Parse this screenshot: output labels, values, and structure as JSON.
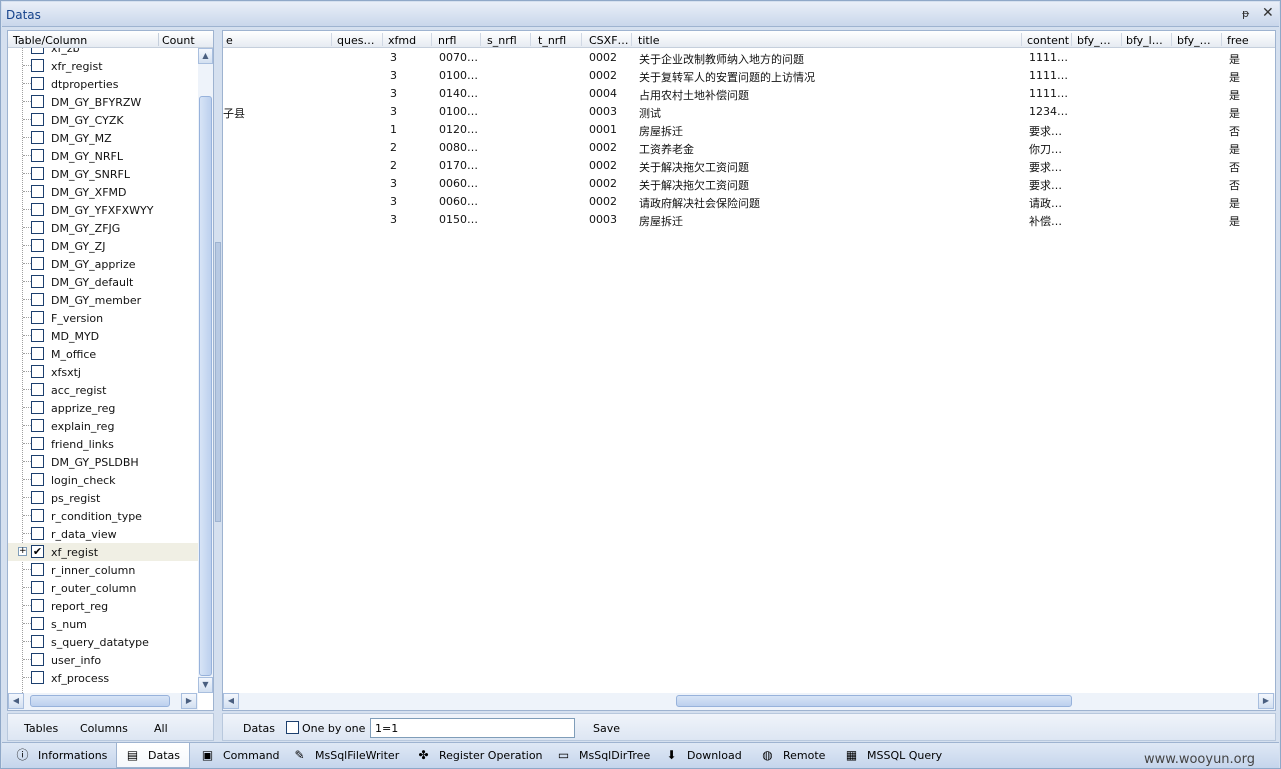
{
  "window": {
    "title": "Datas",
    "pin_glyph": "ᵽ",
    "close_glyph": "✕"
  },
  "tree": {
    "headers": {
      "table_column": "Table/Column",
      "count": "Count"
    },
    "items": [
      {
        "label": "xf_zb",
        "checked": false
      },
      {
        "label": "xfr_regist",
        "checked": false
      },
      {
        "label": "dtproperties",
        "checked": false
      },
      {
        "label": "DM_GY_BFYRZW",
        "checked": false
      },
      {
        "label": "DM_GY_CYZK",
        "checked": false
      },
      {
        "label": "DM_GY_MZ",
        "checked": false
      },
      {
        "label": "DM_GY_NRFL",
        "checked": false
      },
      {
        "label": "DM_GY_SNRFL",
        "checked": false
      },
      {
        "label": "DM_GY_XFMD",
        "checked": false
      },
      {
        "label": "DM_GY_YFXFXWYY",
        "checked": false
      },
      {
        "label": "DM_GY_ZFJG",
        "checked": false
      },
      {
        "label": "DM_GY_ZJ",
        "checked": false
      },
      {
        "label": "DM_GY_apprize",
        "checked": false
      },
      {
        "label": "DM_GY_default",
        "checked": false
      },
      {
        "label": "DM_GY_member",
        "checked": false
      },
      {
        "label": "F_version",
        "checked": false
      },
      {
        "label": "MD_MYD",
        "checked": false
      },
      {
        "label": "M_office",
        "checked": false
      },
      {
        "label": "xfsxtj",
        "checked": false
      },
      {
        "label": "acc_regist",
        "checked": false
      },
      {
        "label": "apprize_reg",
        "checked": false
      },
      {
        "label": "explain_reg",
        "checked": false
      },
      {
        "label": "friend_links",
        "checked": false
      },
      {
        "label": "DM_GY_PSLDBH",
        "checked": false
      },
      {
        "label": "login_check",
        "checked": false
      },
      {
        "label": "ps_regist",
        "checked": false
      },
      {
        "label": "r_condition_type",
        "checked": false
      },
      {
        "label": "r_data_view",
        "checked": false
      },
      {
        "label": "xf_regist",
        "checked": true,
        "expandable": true,
        "selected": true
      },
      {
        "label": "r_inner_column",
        "checked": false
      },
      {
        "label": "r_outer_column",
        "checked": false
      },
      {
        "label": "report_reg",
        "checked": false
      },
      {
        "label": "s_num",
        "checked": false
      },
      {
        "label": "s_query_datatype",
        "checked": false
      },
      {
        "label": "user_info",
        "checked": false
      },
      {
        "label": "xf_process",
        "checked": false
      }
    ]
  },
  "grid": {
    "columns": [
      "e",
      "ques…",
      "xfmd",
      "nrfl",
      "s_nrfl",
      "t_nrfl",
      "CSXF…",
      "title",
      "content",
      "bfy_…",
      "bfy_l…",
      "bfy_…",
      "free"
    ],
    "rows": [
      [
        "",
        "",
        "3",
        "0070…",
        "",
        "",
        "0002",
        "关于企业改制教师纳入地方的问题",
        "1111…",
        "",
        "",
        "",
        "是"
      ],
      [
        "",
        "",
        "3",
        "0100…",
        "",
        "",
        "0002",
        "关于复转军人的安置问题的上访情况",
        "1111…",
        "",
        "",
        "",
        "是"
      ],
      [
        "",
        "",
        "3",
        "0140…",
        "",
        "",
        "0004",
        "占用农村土地补偿问题",
        "1111…",
        "",
        "",
        "",
        "是"
      ],
      [
        "子县",
        "",
        "3",
        "0100…",
        "",
        "",
        "0003",
        "测试",
        "1234…",
        "",
        "",
        "",
        "是"
      ],
      [
        "",
        "",
        "1",
        "0120…",
        "",
        "",
        "0001",
        "房屋拆迁",
        "要求…",
        "",
        "",
        "",
        "否"
      ],
      [
        "",
        "",
        "2",
        "0080…",
        "",
        "",
        "0002",
        "工资养老金",
        "你刀…",
        "",
        "",
        "",
        "是"
      ],
      [
        "",
        "",
        "2",
        "0170…",
        "",
        "",
        "0002",
        "关于解决拖欠工资问题",
        "要求…",
        "",
        "",
        "",
        "否"
      ],
      [
        "",
        "",
        "3",
        "0060…",
        "",
        "",
        "0002",
        "关于解决拖欠工资问题",
        "要求…",
        "",
        "",
        "",
        "否"
      ],
      [
        "",
        "",
        "3",
        "0060…",
        "",
        "",
        "0002",
        "请政府解决社会保险问题",
        "请政…",
        "",
        "",
        "",
        "是"
      ],
      [
        "",
        "",
        "3",
        "0150…",
        "",
        "",
        "0003",
        "房屋拆迁",
        "补偿…",
        "",
        "",
        "",
        "是"
      ]
    ]
  },
  "bottom_left": {
    "tables": "Tables",
    "columns": "Columns",
    "all": "All"
  },
  "bottom_right": {
    "datas": "Datas",
    "one_by_one": "One by one",
    "filter_value": "1=1",
    "save": "Save"
  },
  "tabs": [
    {
      "label": "Informations",
      "icon": "info-icon",
      "glyph": "ⓘ",
      "active": false
    },
    {
      "label": "Datas",
      "icon": "database-icon",
      "glyph": "▤",
      "active": true
    },
    {
      "label": "Command",
      "icon": "command-icon",
      "glyph": "▣",
      "active": false
    },
    {
      "label": "MsSqlFileWriter",
      "icon": "pencil-icon",
      "glyph": "✎",
      "active": false
    },
    {
      "label": "Register Operation",
      "icon": "register-icon",
      "glyph": "✤",
      "active": false
    },
    {
      "label": "MsSqlDirTree",
      "icon": "folder-icon",
      "glyph": "▭",
      "active": false
    },
    {
      "label": "Download",
      "icon": "download-icon",
      "glyph": "⬇",
      "active": false
    },
    {
      "label": "Remote",
      "icon": "globe-icon",
      "glyph": "◍",
      "active": false
    },
    {
      "label": "MSSQL Query",
      "icon": "sql-icon",
      "glyph": "▦",
      "active": false
    }
  ],
  "watermark": "www.wooyun.org",
  "colors": {
    "accent": "#15428b",
    "selected_row": "#f0efe4",
    "panel": "#d5e0ef"
  }
}
